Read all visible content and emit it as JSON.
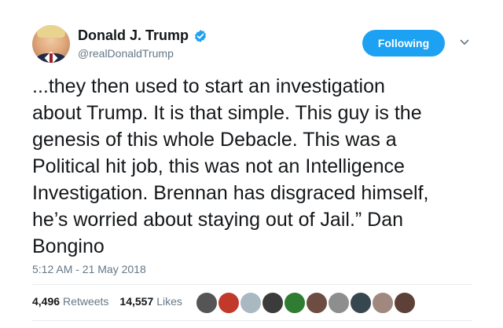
{
  "author": {
    "display_name": "Donald J. Trump",
    "handle": "@realDonaldTrump",
    "verified": true
  },
  "follow_button": {
    "label": "Following",
    "color": "#1da1f2"
  },
  "tweet": {
    "text": "...they then used to start an investigation\nabout Trump. It is that simple. This guy is the\ngenesis of this whole Debacle. This was a\nPolitical hit job, this was not an Intelligence\nInvestigation. Brennan has disgraced himself,\nhe’s worried about staying out of Jail.” Dan\nBongino",
    "timestamp": "5:12 AM - 21 May 2018"
  },
  "stats": {
    "retweets_count": "4,496",
    "retweets_label": "Retweets",
    "likes_count": "14,557",
    "likes_label": "Likes"
  },
  "likers": [
    {
      "color": "#555555"
    },
    {
      "color": "#c0392b"
    },
    {
      "color": "#aab8c2"
    },
    {
      "color": "#3b3b3b"
    },
    {
      "color": "#2e7d32"
    },
    {
      "color": "#6d4c41"
    },
    {
      "color": "#8e8e8e"
    },
    {
      "color": "#37474f"
    },
    {
      "color": "#a1887f"
    },
    {
      "color": "#5d4037"
    }
  ]
}
